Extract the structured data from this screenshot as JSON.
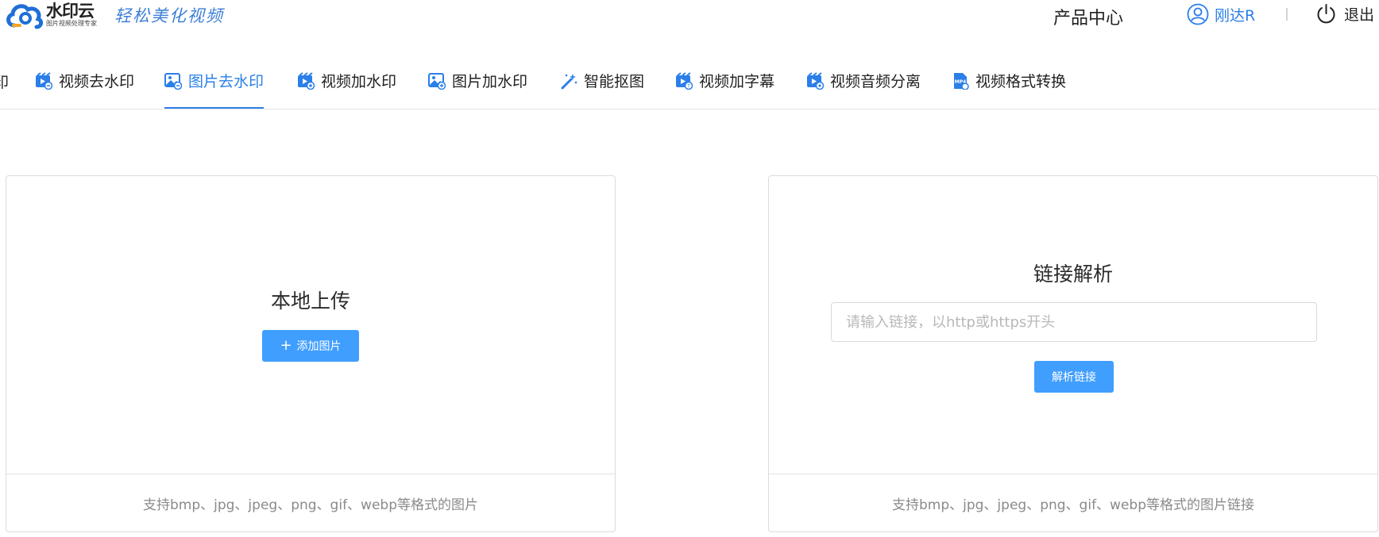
{
  "header": {
    "logo_name": "水印云",
    "logo_subtitle": "图片视频处理专家",
    "slogan": "轻松美化视频",
    "product_center": "产品中心",
    "username": "刚达R",
    "logout": "退出"
  },
  "nav": {
    "truncated_label": "印",
    "tabs": [
      {
        "label": "视频去水印",
        "icon": "video-icon",
        "active": false
      },
      {
        "label": "图片去水印",
        "icon": "image-icon",
        "active": true
      },
      {
        "label": "视频加水印",
        "icon": "video-icon",
        "active": false
      },
      {
        "label": "图片加水印",
        "icon": "image-icon",
        "active": false
      },
      {
        "label": "智能抠图",
        "icon": "magic-wand-icon",
        "active": false
      },
      {
        "label": "视频加字幕",
        "icon": "video-icon",
        "active": false
      },
      {
        "label": "视频音频分离",
        "icon": "video-icon",
        "active": false
      },
      {
        "label": "视频格式转换",
        "icon": "mp4-file-icon",
        "active": false
      }
    ]
  },
  "local_upload": {
    "title": "本地上传",
    "button_label": "添加图片",
    "footer": "支持bmp、jpg、jpeg、png、gif、webp等格式的图片"
  },
  "link_parse": {
    "title": "链接解析",
    "input_placeholder": "请输入链接，以http或https开头",
    "input_value": "",
    "button_label": "解析链接",
    "footer": "支持bmp、jpg、jpeg、png、gif、webp等格式的图片链接"
  },
  "colors": {
    "accent": "#2b7fe8",
    "button": "#409eff",
    "muted_text": "#8a8a8a"
  }
}
